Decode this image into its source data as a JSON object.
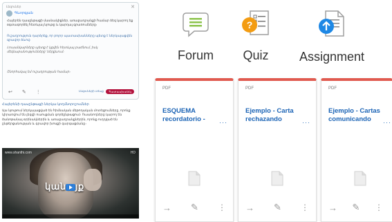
{
  "left": {
    "post": {
      "meta": "Լեզուներ",
      "author": "Գևորգյան",
      "p1": "Հայերեն դասընթացի մասնակիցներ, առաջադրանքի համար ձեզ կարող եք օգտագործել հետևյալ նյութը և կարդալ գրառումները։",
      "p2": "Ուշադրություն դարձրեք, որ բոլոր պատասխանները պետք է ներկայացվեն գրավոր ձևով։",
      "p3": "Լուսանկարները պետք է կցվեն հետևյալ բաժնում, իսկ մեկնաբանությունները՝ ներքևում։",
      "p4": "Շնորհակալ եմ ուշադրության համար։",
      "tag": "Լեզուների տեսք",
      "reply": "Պատասխանել"
    },
    "article": {
      "heading": "Հայերենի դասընթացի ներկա կողմնորոշումներ",
      "text": "Այս նյութում ներկայացված են հիմնական մեթոդական մոտեցումները, որոնք կիրառվում են լեզվի ուսուցման գործընթացում։ Ուսանողները կարող են ծանոթանալ օրինակներին և առաջադրանքներին, որոնք ուղղված են ընթերցանության և գրավոր խոսքի զարգացմանը։"
    },
    "video": {
      "brand": "www.shanthi.com",
      "corner": "HD",
      "title": "կանայք"
    }
  },
  "tools": {
    "forum": "Forum",
    "quiz": "Quiz",
    "assignment": "Assignment"
  },
  "cards": [
    {
      "type": "PDF",
      "title": "ESQUEMA recordatorio -"
    },
    {
      "type": "PDF",
      "title": "Ejemplo - Carta rechazando"
    },
    {
      "type": "PDF",
      "title": "Ejemplo - Cartas comunicando"
    }
  ],
  "colors": {
    "accent_bar": "#e05a4f",
    "link": "#1a63b5",
    "forum_icon": "#8bc34a",
    "quiz_icon": "#f39c12",
    "assignment_icon": "#1e88e5"
  }
}
